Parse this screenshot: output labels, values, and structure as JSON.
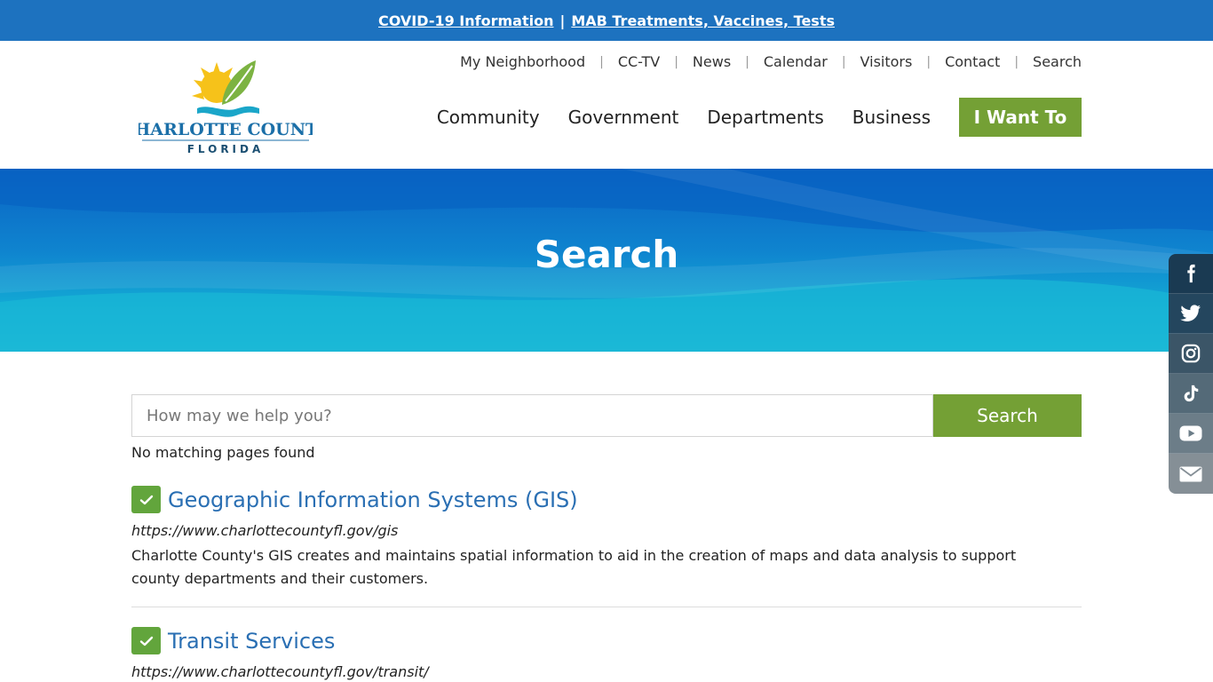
{
  "alert": {
    "link1": "COVID-19 Information",
    "separator": "|",
    "link2": "MAB Treatments, Vaccines, Tests"
  },
  "logo": {
    "line1": "CHARLOTTE COUNTY",
    "line2": "FLORIDA"
  },
  "utility_nav": [
    "My Neighborhood",
    "CC-TV",
    "News",
    "Calendar",
    "Visitors",
    "Contact",
    "Search"
  ],
  "main_nav": {
    "items": [
      "Community",
      "Government",
      "Departments",
      "Business"
    ],
    "cta": "I Want To"
  },
  "hero": {
    "title": "Search"
  },
  "search": {
    "placeholder": "How may we help you?",
    "button": "Search",
    "status": "No matching pages found"
  },
  "results": [
    {
      "title": "Geographic Information Systems (GIS)",
      "url": "https://www.charlottecountyfl.gov/gis",
      "description": "Charlotte County's GIS creates and maintains spatial information to aid in the creation of maps and data analysis to support county departments and their customers."
    },
    {
      "title": "Transit Services",
      "url": "https://www.charlottecountyfl.gov/transit/"
    }
  ],
  "social": [
    "facebook-icon",
    "twitter-icon",
    "instagram-icon",
    "tiktok-icon",
    "youtube-icon",
    "email-icon"
  ],
  "colors": {
    "alert_bar": "#1d72bf",
    "accent_green": "#74a035",
    "link_blue": "#2a6fb3",
    "check_green": "#62a53c"
  }
}
